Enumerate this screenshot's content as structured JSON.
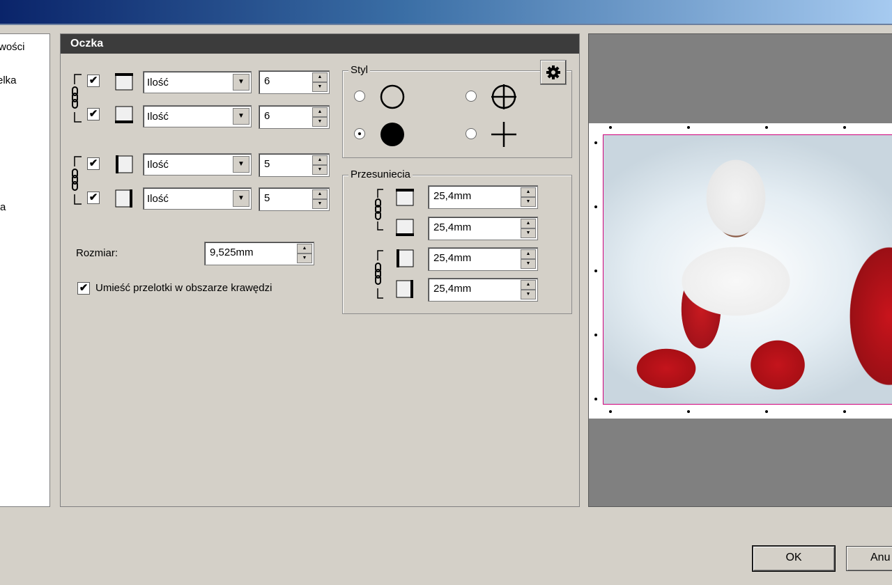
{
  "left_nav": {
    "items": [
      {
        "label": "wości"
      },
      {
        "label": "elka"
      },
      {
        "label": "a"
      }
    ]
  },
  "panel": {
    "title": "Oczka",
    "rows": [
      {
        "edge": "top",
        "checked": true,
        "mode": "Ilość",
        "count": "6"
      },
      {
        "edge": "bottom",
        "checked": true,
        "mode": "Ilość",
        "count": "6"
      },
      {
        "edge": "left",
        "checked": true,
        "mode": "Ilość",
        "count": "5"
      },
      {
        "edge": "right",
        "checked": true,
        "mode": "Ilość",
        "count": "5"
      }
    ],
    "size_label": "Rozmiar:",
    "size_value": "9,525mm",
    "place_in_bleed_label": "Umieść przelotki w obszarze krawędzi",
    "place_in_bleed_checked": true
  },
  "style_group": {
    "label": "Styl",
    "options": [
      {
        "name": "circle-outline",
        "selected": false
      },
      {
        "name": "circle-crosshair",
        "selected": false
      },
      {
        "name": "circle-filled",
        "selected": true
      },
      {
        "name": "plus-cross",
        "selected": false
      }
    ],
    "settings_icon": "gear-icon"
  },
  "offsets_group": {
    "label": "Przesuniecia",
    "values": [
      {
        "edge": "top",
        "value": "25,4mm"
      },
      {
        "edge": "bottom",
        "value": "25,4mm"
      },
      {
        "edge": "left",
        "value": "25,4mm"
      },
      {
        "edge": "right",
        "value": "25,4mm"
      }
    ]
  },
  "buttons": {
    "ok": "OK",
    "cancel": "Anu"
  },
  "colors": {
    "panel_bg": "#d4d0c8",
    "header_bg": "#3c3c3c",
    "preview_bg": "#808080",
    "trim_line": "#d0007a"
  }
}
